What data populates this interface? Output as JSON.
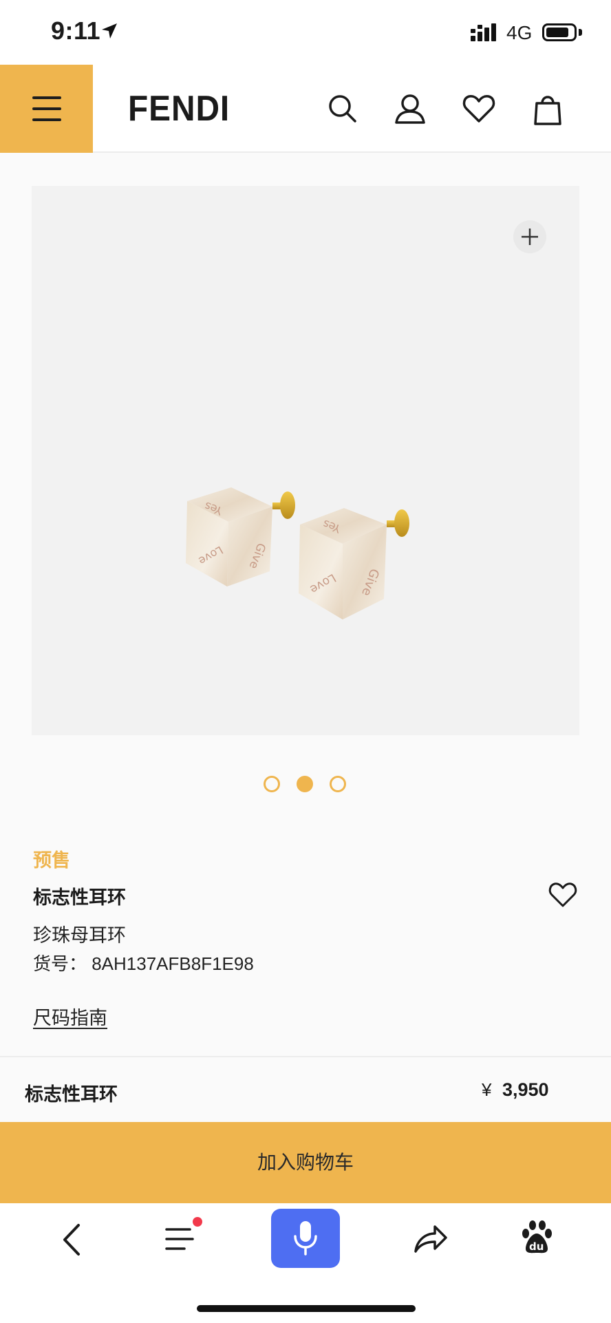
{
  "status_bar": {
    "time": "9:11",
    "network": "4G"
  },
  "header": {
    "brand": "FENDI",
    "icons": [
      "menu-icon",
      "search-icon",
      "account-icon",
      "heart-icon",
      "shopping-bag-icon"
    ],
    "accent_color": "#efb54e"
  },
  "gallery": {
    "image_description_icon": "cube-earrings-image",
    "image_engravings": [
      "Yes",
      "Love",
      "Give"
    ],
    "zoom_icon": "plus-icon",
    "pages": 3,
    "active_page": 2
  },
  "product": {
    "badge": "预售",
    "title": "标志性耳环",
    "material": "珍珠母耳环",
    "sku": "货号：  8AH137AFB8F1E98",
    "size_guide": "尺码指南"
  },
  "price_bar": {
    "name": "标志性耳环",
    "currency": "¥",
    "price": "3,950"
  },
  "cart": {
    "label": "加入购物车"
  },
  "browser_toolbar": {
    "icons": [
      "back-icon",
      "menu-list-icon",
      "microphone-icon",
      "share-icon",
      "baidu-paw-icon"
    ],
    "mic_color": "#4e6ef2",
    "notification_color": "#f2394b"
  }
}
